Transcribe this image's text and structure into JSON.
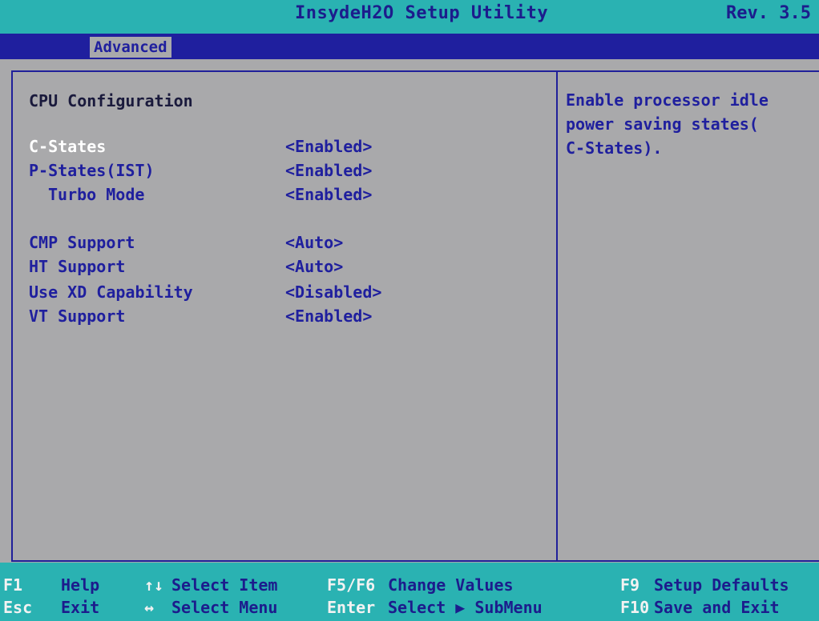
{
  "header": {
    "title": "InsydeH2O Setup Utility",
    "revision": "Rev. 3.5"
  },
  "menu": {
    "active_tab": "Advanced"
  },
  "section": {
    "title": "CPU Configuration"
  },
  "settings": [
    {
      "label": "C-States",
      "value": "<Enabled>",
      "selected": true
    },
    {
      "label": "P-States(IST)",
      "value": "<Enabled>"
    },
    {
      "label": "Turbo Mode",
      "value": "<Enabled>",
      "indented": true
    },
    {
      "label": "CMP Support",
      "value": "<Auto>"
    },
    {
      "label": "HT Support",
      "value": "<Auto>"
    },
    {
      "label": "Use XD Capability",
      "value": "<Disabled>"
    },
    {
      "label": "VT Support",
      "value": "<Enabled>"
    }
  ],
  "help": {
    "lines": [
      "Enable processor idle",
      "power saving states(",
      "C-States)."
    ]
  },
  "footer": {
    "row1": [
      {
        "key": "F1",
        "desc": "Help"
      },
      {
        "key": "↑↓",
        "desc": "Select Item"
      },
      {
        "key": "F5/F6",
        "desc": "Change Values"
      },
      {
        "key": "F9",
        "desc": "Setup Defaults"
      }
    ],
    "row2": [
      {
        "key": "Esc",
        "desc": "Exit"
      },
      {
        "key": "↔",
        "desc": "Select Menu"
      },
      {
        "key": "Enter",
        "desc": "Select ▶ SubMenu"
      },
      {
        "key": "F10",
        "desc": "Save and Exit"
      }
    ]
  },
  "colors": {
    "title_bar": "#2ab2b2",
    "menu_bar": "#1f1f9e",
    "background": "#a9a9ab",
    "text_blue": "#1f1f9e",
    "selected_text": "#ffffff"
  }
}
